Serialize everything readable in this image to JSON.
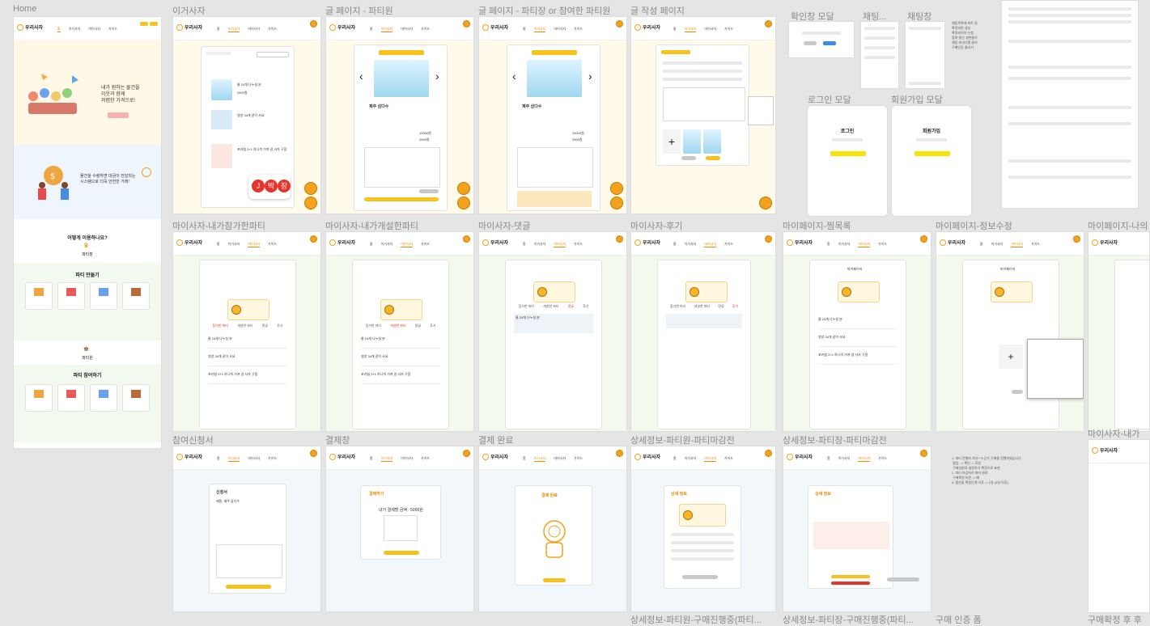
{
  "frames": {
    "home": {
      "label": "Home"
    },
    "igeosaja": {
      "label": "이거사자"
    },
    "post_member": {
      "label": "글 페이지 - 파티원"
    },
    "post_leader": {
      "label": "글 페이지 - 파티장 or 참여한 파티원"
    },
    "write": {
      "label": "글 작성 페이지"
    },
    "confirm_modal": {
      "label": "확인창 모달"
    },
    "chat_small": {
      "label": "채팅..."
    },
    "chat": {
      "label": "채팅창"
    },
    "login_modal": {
      "label": "로그인 모달"
    },
    "signup_modal": {
      "label": "회원가입 모달"
    },
    "my_joined": {
      "label": "마이사자-내가참가한파티"
    },
    "my_opened": {
      "label": "마이사자-내가개설한파티"
    },
    "my_comments": {
      "label": "마이사자-댓글"
    },
    "my_reviews": {
      "label": "마이사자-후기"
    },
    "mypage_wish": {
      "label": "마이페이지-찜목록"
    },
    "mypage_edit": {
      "label": "마이페이지-정보수정"
    },
    "mypage_more": {
      "label": "마이페이지-나의"
    },
    "apply": {
      "label": "참여신청서"
    },
    "payment": {
      "label": "결제창"
    },
    "pay_done": {
      "label": "결제 완료"
    },
    "detail_member": {
      "label": "상세정보-파티원-파티마감전"
    },
    "detail_leader": {
      "label": "상세정보-파티장-파티마감전"
    },
    "my_more2": {
      "label": "마이사자-내가"
    },
    "bottom1": {
      "label": "상세정보-파티원-구매진행중(파티..."
    },
    "bottom2": {
      "label": "상세정보-파티장-구매진행중(파티..."
    },
    "bottom3": {
      "label": "구매 인증 폼"
    },
    "bottom4": {
      "label": "구매확정 후 후"
    }
  },
  "app": {
    "brand": "우리사자",
    "nav": [
      "홈",
      "이거사자",
      "마이사자",
      "가이드"
    ]
  },
  "home": {
    "hero1": "내가 원하는 물건을\n이웃과 함께\n저렴한 가격으로!",
    "hero2": "물건을 수령하면 대금이 전달되는\n시스템으로 더욱 안전한 거래!",
    "how": "어떻게 이용하나요?",
    "leader": "파티장",
    "make_party": "파티 만들기",
    "member": "파티원",
    "join_party": "파티 참여하기"
  },
  "post": {
    "title": "제주 삼다수",
    "product": "물 24개 나누실 분",
    "price1": "10000원",
    "price2": "2500원"
  },
  "post_leader_extra": {
    "detail_label": "상세 정보"
  },
  "modals": {
    "login_title": "로그인",
    "signup_title": "회원가입"
  },
  "mypage": {
    "title": "마이페이지",
    "tabs": [
      "참가한 파티",
      "개설한 파티",
      "댓글",
      "후기"
    ],
    "item1": "물 24개 나누실 분",
    "item2": "영양 34개 같이 사요",
    "item3": "포카칩 3+1 하나씩 가져 갈 사자 구함"
  },
  "apply": {
    "title": "신청서",
    "product": "제품: 제주 삼다수"
  },
  "payment": {
    "title": "결제하기",
    "amount": "내가 결제할 금액 : 5000원"
  },
  "pay_done": {
    "title": "결제 완료"
  },
  "detail": {
    "title": "상세 정보"
  },
  "notes": {
    "chat_list": "채팅목록에 파트 정\n확정되면 생성\n확정되어야 신청\n참여 중인 생판들이\n채팅 보내기를 들어\n구매인증 올리기",
    "flow": "1. 파티 진행자 자유? 누군가 구매을 진행하였습니다\n 말입: -> 확인 -> 후방\n 구매성완료 설정하기 확정으로 표현\n2. 파티 마감처리 파티 완료\n 구매확정 버전 -> 예\n3. 환산을 확정단계 이후 -> 1일 (3일 이후)"
  },
  "colors": {
    "accent": "#f4a11d",
    "yellow": "#f6c21b",
    "red": "#e8332a",
    "canvas": "#e5e5e5"
  }
}
